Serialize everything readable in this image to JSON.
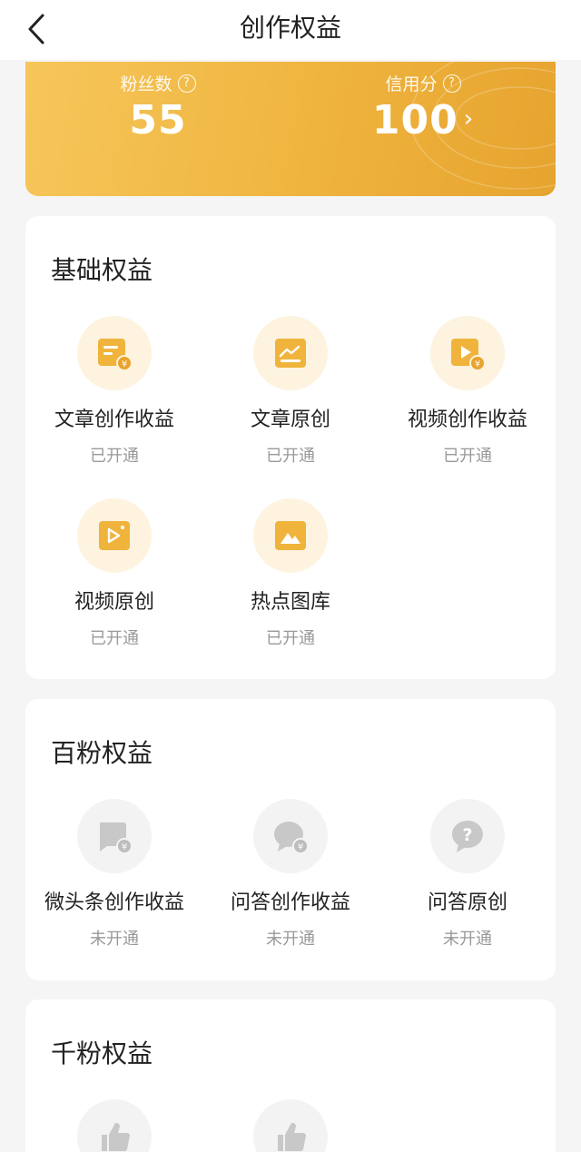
{
  "header": {
    "title": "创作权益"
  },
  "stats": {
    "fans": {
      "label": "粉丝数",
      "value": "55"
    },
    "credit": {
      "label": "信用分",
      "value": "100"
    }
  },
  "colors": {
    "accent": "#efb43e",
    "icon_bg": "#fdf3df",
    "icon_gold": "#f0b43c",
    "disabled": "#c8c8c8"
  },
  "sections": [
    {
      "title": "基础权益",
      "items": [
        {
          "label": "文章创作收益",
          "status": "已开通",
          "icon": "article-income-icon"
        },
        {
          "label": "文章原创",
          "status": "已开通",
          "icon": "article-original-icon"
        },
        {
          "label": "视频创作收益",
          "status": "已开通",
          "icon": "video-income-icon"
        },
        {
          "label": "视频原创",
          "status": "已开通",
          "icon": "video-original-icon"
        },
        {
          "label": "热点图库",
          "status": "已开通",
          "icon": "image-library-icon"
        }
      ]
    },
    {
      "title": "百粉权益",
      "items": [
        {
          "label": "微头条创作收益",
          "status": "未开通",
          "icon": "micro-post-income-icon"
        },
        {
          "label": "问答创作收益",
          "status": "未开通",
          "icon": "qa-income-icon"
        },
        {
          "label": "问答原创",
          "status": "未开通",
          "icon": "qa-original-icon"
        }
      ]
    },
    {
      "title": "千粉权益",
      "items": []
    }
  ]
}
